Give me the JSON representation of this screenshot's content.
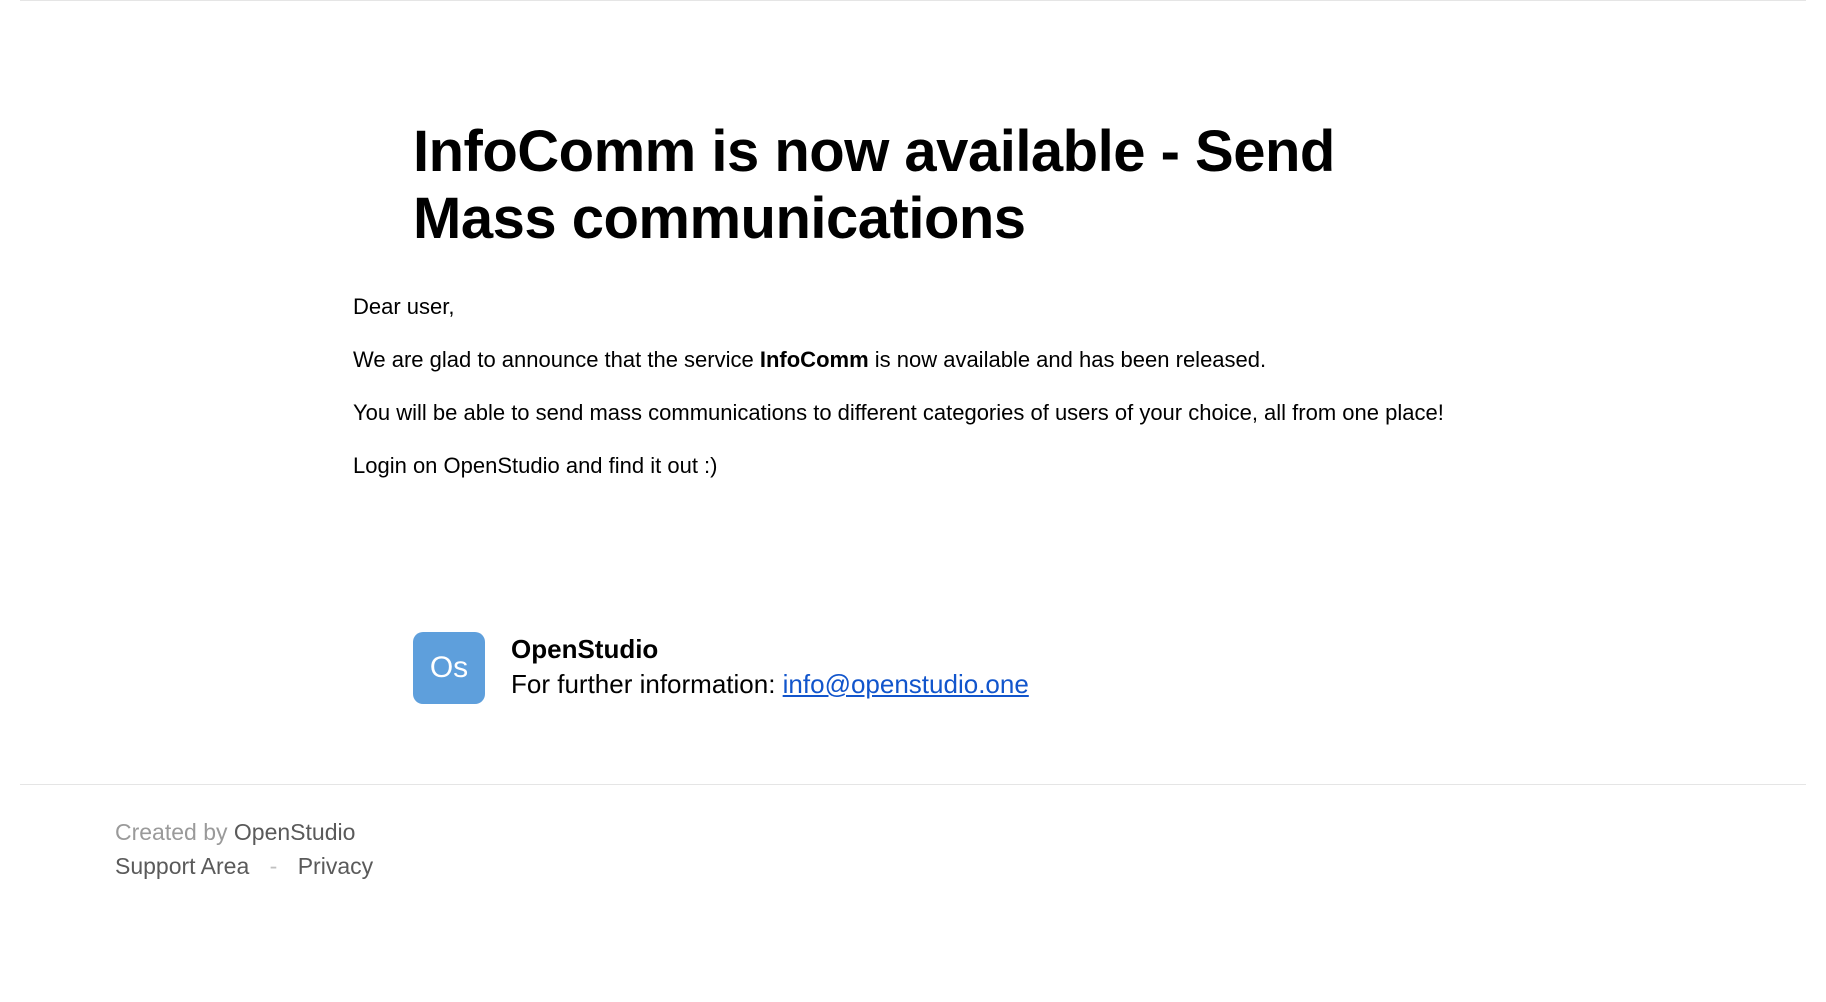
{
  "heading": "InfoComm is now available - Send Mass communications",
  "body": {
    "greeting": "Dear user,",
    "p1_pre": "We are glad to announce that the service ",
    "p1_bold": "InfoComm",
    "p1_post": " is now available and has been released.",
    "p2": "You will be able to send mass communications to different categories of users of your choice, all from one place!",
    "p3": "Login on OpenStudio and find it out :)"
  },
  "signature": {
    "logo_text": "Os",
    "name": "OpenStudio",
    "info_label": "For further information: ",
    "email": "info@openstudio.one"
  },
  "footer": {
    "created_by_label": "Created by ",
    "created_by_name": "OpenStudio",
    "support_link": "Support Area",
    "separator": "-",
    "privacy_link": "Privacy"
  },
  "colors": {
    "logo_bg": "#5e9fdc",
    "link": "#1155cc"
  }
}
